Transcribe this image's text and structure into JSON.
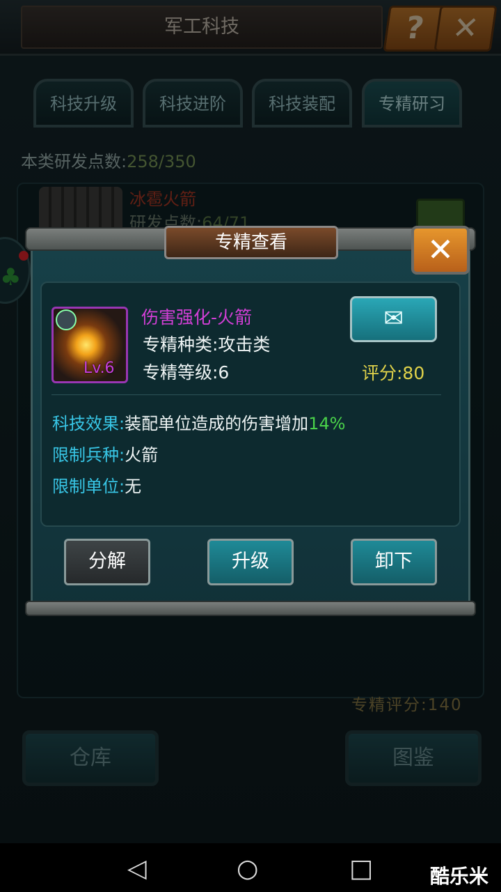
{
  "header": {
    "title": "军工科技",
    "help_icon": "question-mark-icon",
    "close_icon": "close-x-icon"
  },
  "tabs": [
    {
      "label": "科技升级"
    },
    {
      "label": "科技进阶"
    },
    {
      "label": "科技装配"
    },
    {
      "label": "专精研习",
      "active": true
    }
  ],
  "research": {
    "label": "本类研发点数:",
    "value": "258/350"
  },
  "item": {
    "name": "冰雹火箭",
    "points_label": "研发点数:",
    "points_value": "64/71"
  },
  "spec_score": "专精评分:140",
  "bottom": {
    "warehouse": "仓库",
    "codex": "图鉴"
  },
  "modal": {
    "title": "专精查看",
    "tech_name": "伤害强化-火箭",
    "tech_type": "专精种类:攻击类",
    "tech_level": "专精等级:6",
    "level_badge": "Lv.6",
    "score": "评分:80",
    "effect_key": "科技效果:",
    "effect_text": "装配单位造成的伤害增加",
    "effect_value": "14%",
    "troop_key": "限制兵种:",
    "troop_value": "火箭",
    "unit_key": "限制单位:",
    "unit_value": "无",
    "btn_decompose": "分解",
    "btn_upgrade": "升级",
    "btn_unequip": "卸下"
  },
  "watermark": "酷乐米"
}
